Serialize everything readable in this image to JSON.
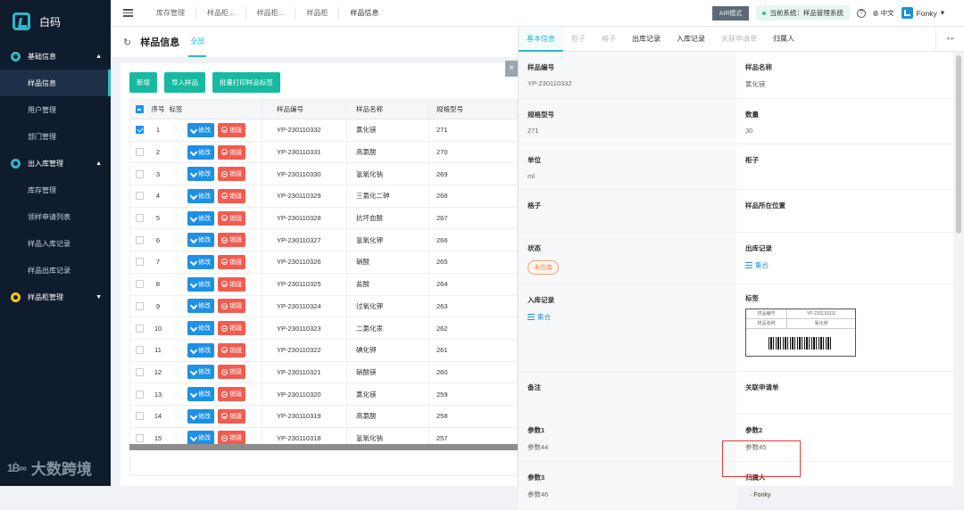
{
  "app": {
    "name": "白码"
  },
  "sidebar": {
    "groups": [
      {
        "label": "基础信息",
        "items": [
          "样品信息",
          "用户管理",
          "部门管理"
        ]
      },
      {
        "label": "出入库管理",
        "items": [
          "库存管理",
          "领样申请列表",
          "样品入库记录",
          "样品出库记录"
        ]
      },
      {
        "label": "样品柜管理",
        "items": []
      }
    ],
    "watermark": "大数跨境",
    "watermark_mark": "1Ḃ∞"
  },
  "topbar": {
    "breadcrumbs": [
      "库存管理",
      "样品柜...",
      "样品柜...",
      "样品柜",
      "样品信息"
    ],
    "air_mode": "AIR模式",
    "current_system": "当前系统：样品管理系统",
    "help": "?",
    "lang": "中文",
    "user": "Fonky"
  },
  "page": {
    "title": "样品信息",
    "tab": "全部"
  },
  "toolbar": {
    "add": "新增",
    "import": "导入样品",
    "print": "批量打印样品标签"
  },
  "table": {
    "headers": {
      "seq": "序号",
      "tag": "标签",
      "code": "样品编号",
      "name": "样品名称",
      "spec": "规格型号"
    },
    "edit_label": "修改",
    "delete_label": "销毁",
    "rows": [
      {
        "seq": "1",
        "code": "YP-230110332",
        "name": "氯化镁",
        "spec": "271"
      },
      {
        "seq": "2",
        "code": "YP-230110331",
        "name": "高氯酸",
        "spec": "270"
      },
      {
        "seq": "3",
        "code": "YP-230110330",
        "name": "氢氧化钠",
        "spec": "269"
      },
      {
        "seq": "4",
        "code": "YP-230110329",
        "name": "三氯化二砷",
        "spec": "268"
      },
      {
        "seq": "5",
        "code": "YP-230110328",
        "name": "抗坏血酸",
        "spec": "267"
      },
      {
        "seq": "6",
        "code": "YP-230110327",
        "name": "氢氧化钾",
        "spec": "266"
      },
      {
        "seq": "7",
        "code": "YP-230110326",
        "name": "硝酸",
        "spec": "265"
      },
      {
        "seq": "8",
        "code": "YP-230110325",
        "name": "盐酸",
        "spec": "264"
      },
      {
        "seq": "9",
        "code": "YP-230110324",
        "name": "过氧化钾",
        "spec": "263"
      },
      {
        "seq": "10",
        "code": "YP-230110323",
        "name": "二氯化汞",
        "spec": "262"
      },
      {
        "seq": "11",
        "code": "YP-230110322",
        "name": "碘化钾",
        "spec": "261"
      },
      {
        "seq": "12",
        "code": "YP-230110321",
        "name": "硝酸镁",
        "spec": "260"
      },
      {
        "seq": "13",
        "code": "YP-230110320",
        "name": "氯化镁",
        "spec": "259"
      },
      {
        "seq": "14",
        "code": "YP-230110319",
        "name": "高氯酸",
        "spec": "258"
      },
      {
        "seq": "15",
        "code": "YP-230110318",
        "name": "氢氧化钠",
        "spec": "257"
      }
    ]
  },
  "panel": {
    "close": "×",
    "tabs": [
      "基本信息",
      "柜子",
      "格子",
      "出库记录",
      "入库记录",
      "关联申请单",
      "归属人"
    ],
    "nav": "◂ ▸",
    "fields": {
      "code_label": "样品编号",
      "code": "YP-230110332",
      "name_label": "样品名称",
      "name": "氯化镁",
      "spec_label": "规格型号",
      "spec": "271",
      "qty_label": "数量",
      "qty": "30",
      "unit_label": "单位",
      "unit": "ml",
      "cabinet_label": "柜子",
      "grid_label": "格子",
      "location_label": "样品所在位置",
      "status_label": "状态",
      "status": "未在库",
      "out_label": "出库记录",
      "out_link": "集合",
      "in_label": "入库记录",
      "in_link": "集合",
      "tag_label": "标签",
      "tag_card": {
        "k1": "样品编号",
        "v1": "YP-230110332",
        "k2": "样品名称",
        "v2": "氯化镁"
      },
      "remark_label": "备注",
      "req_label": "关联申请单",
      "p1_label": "参数1",
      "p1": "参数44",
      "p2_label": "参数2",
      "p2": "参数45",
      "p3_label": "参数3",
      "p3": "参数46",
      "owner_label": "归属人",
      "owner": "Fonky"
    }
  }
}
